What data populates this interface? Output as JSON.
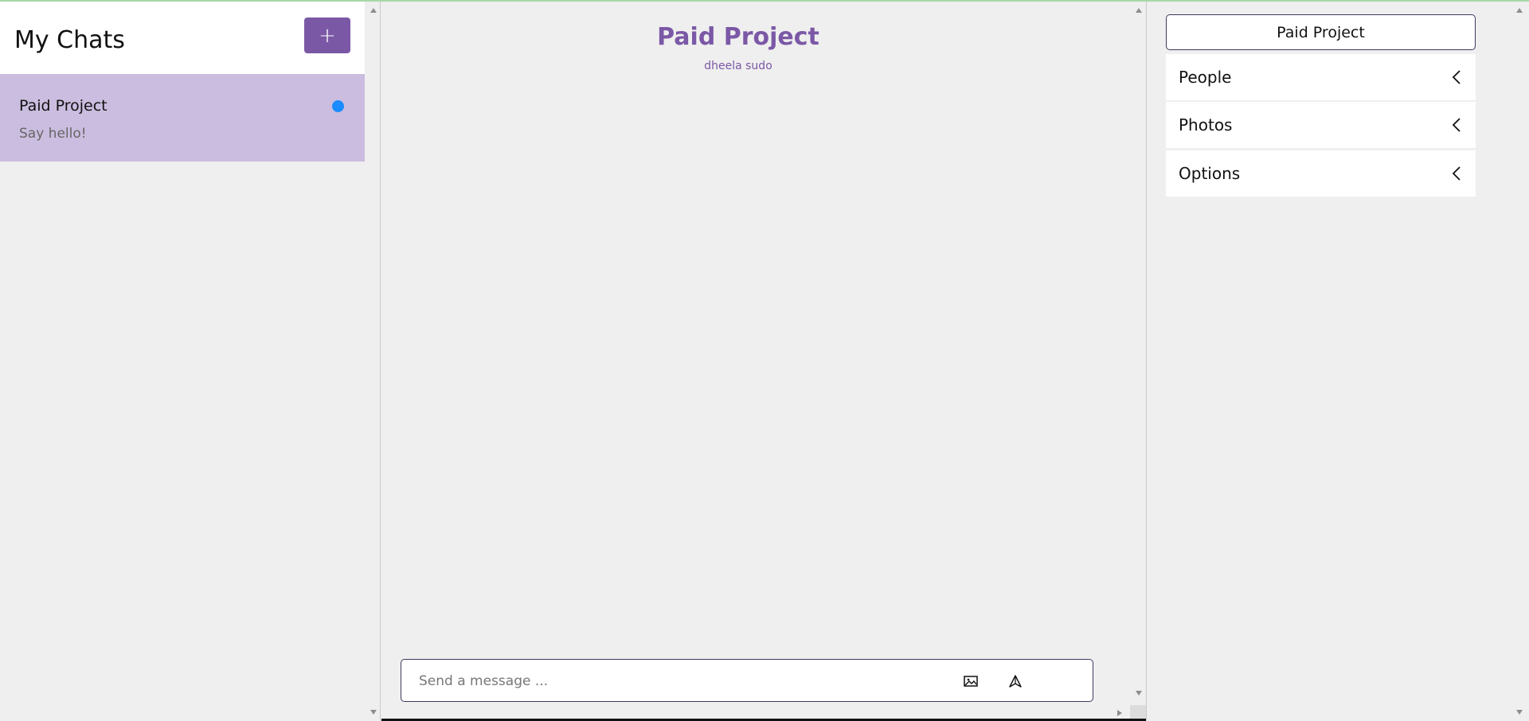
{
  "sidebar": {
    "title": "My Chats",
    "add_button_label": "+",
    "chats": [
      {
        "name": "Paid Project",
        "preview": "Say hello!",
        "unread": true
      }
    ]
  },
  "conversation": {
    "title": "Paid Project",
    "subtitle": "dheela sudo",
    "composer": {
      "placeholder": "Send a message ...",
      "value": "",
      "image_icon": "image-icon",
      "send_icon": "send-icon"
    }
  },
  "details": {
    "group_name": "Paid Project",
    "sections": [
      {
        "label": "People",
        "icon": "chevron-left-icon"
      },
      {
        "label": "Photos",
        "icon": "chevron-left-icon"
      },
      {
        "label": "Options",
        "icon": "chevron-left-icon"
      }
    ]
  },
  "colors": {
    "accent": "#7b58a6",
    "selected_chat": "#cbbddf",
    "unread_dot": "#1a8cff",
    "background": "#efefef"
  }
}
